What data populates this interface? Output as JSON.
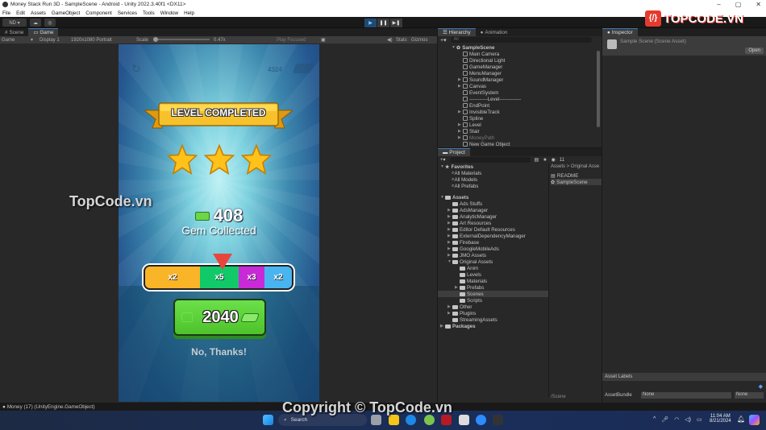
{
  "window": {
    "title": "Money Stack Run 3D - SampleScene - Android - Unity 2022.3.40f1 <DX11>",
    "controls": [
      "–",
      "▢",
      "✕"
    ]
  },
  "menu": [
    "File",
    "Edit",
    "Assets",
    "GameObject",
    "Component",
    "Services",
    "Tools",
    "Window",
    "Help"
  ],
  "toolbar": {
    "account_label": "ND ▾",
    "play_icons": [
      "▶",
      "❚❚",
      "▶❚"
    ]
  },
  "game_panel": {
    "tabs": [
      "Scene",
      "Game"
    ],
    "game_dropdown": "Game",
    "display": "Display 1",
    "resolution": "1920x1080 Portrait",
    "scale_label": "Scale",
    "scale_value": "0.47x",
    "play_mode": "Play Focused",
    "stats": "Stats",
    "gizmos": "Gizmos"
  },
  "game_ui": {
    "money_top": "4324",
    "banner_text": "LEVEL COMPLETED",
    "stars_earned": 3,
    "stars_total": 3,
    "gem_count": "408",
    "gem_label": "Gem Collected",
    "multipliers": [
      {
        "label": "x2",
        "color": "#f9b428"
      },
      {
        "label": "x5",
        "color": "#12c96a"
      },
      {
        "label": "x3",
        "color": "#c92ad8"
      },
      {
        "label": "x2",
        "color": "#49b5f0"
      }
    ],
    "claim_value": "2040",
    "no_thanks": "No, Thanks!"
  },
  "hierarchy": {
    "tabs": [
      "Hierarchy",
      "Animation"
    ],
    "search_placeholder": "All",
    "scene": "SampleScene",
    "items": [
      {
        "name": "Main Camera",
        "expandable": false
      },
      {
        "name": "Directional Light",
        "expandable": false
      },
      {
        "name": "GameManager",
        "expandable": false
      },
      {
        "name": "MenuManager",
        "expandable": false
      },
      {
        "name": "SoundManager",
        "expandable": true
      },
      {
        "name": "Canvas",
        "expandable": true
      },
      {
        "name": "EventSystem",
        "expandable": false
      },
      {
        "name": "-----------Level-------------",
        "expandable": false
      },
      {
        "name": "EndPoint",
        "expandable": false
      },
      {
        "name": "InvisibleTrack",
        "expandable": true
      },
      {
        "name": "Spline",
        "expandable": false
      },
      {
        "name": "Level",
        "expandable": true
      },
      {
        "name": "Stair",
        "expandable": true
      },
      {
        "name": "MoneyPath",
        "expandable": true,
        "disabled": true
      },
      {
        "name": "New Game Object",
        "expandable": false
      }
    ]
  },
  "project": {
    "tab": "Project",
    "count_badge": "11",
    "favorites_label": "Favorites",
    "favorites": [
      "All Materials",
      "All Models",
      "All Prefabs"
    ],
    "assets_label": "Assets",
    "tree": [
      {
        "name": "Ads Stuffs",
        "depth": 1,
        "expandable": false
      },
      {
        "name": "AdsManager",
        "depth": 1,
        "expandable": true
      },
      {
        "name": "AnalyticManager",
        "depth": 1,
        "expandable": true
      },
      {
        "name": "Art Resources",
        "depth": 1,
        "expandable": true
      },
      {
        "name": "Editor Default Resources",
        "depth": 1,
        "expandable": true
      },
      {
        "name": "ExternalDependencyManager",
        "depth": 1,
        "expandable": true
      },
      {
        "name": "Firebase",
        "depth": 1,
        "expandable": true
      },
      {
        "name": "GoogleMobileAds",
        "depth": 1,
        "expandable": true
      },
      {
        "name": "JMO Assets",
        "depth": 1,
        "expandable": true
      },
      {
        "name": "Original Assets",
        "depth": 1,
        "expandable": true,
        "open": true
      },
      {
        "name": "Anim",
        "depth": 2,
        "expandable": false
      },
      {
        "name": "Levels",
        "depth": 2,
        "expandable": false
      },
      {
        "name": "Materials",
        "depth": 2,
        "expandable": false
      },
      {
        "name": "Prefabs",
        "depth": 2,
        "expandable": true
      },
      {
        "name": "Scenes",
        "depth": 2,
        "expandable": false,
        "selected": true
      },
      {
        "name": "Scripts",
        "depth": 2,
        "expandable": false
      },
      {
        "name": "Other",
        "depth": 1,
        "expandable": true
      },
      {
        "name": "Plugins",
        "depth": 1,
        "expandable": true
      },
      {
        "name": "StreamingAssets",
        "depth": 1,
        "expandable": false
      }
    ],
    "packages_label": "Packages",
    "breadcrumb": "Assets > Original Asse",
    "files": [
      "README",
      "SampleScene"
    ],
    "footer_path": "/Scene"
  },
  "inspector": {
    "tab": "Inspector",
    "title": "Sample Scene (Scene Asset)",
    "open_button": "Open",
    "asset_labels": "Asset Labels",
    "assetbundle_label": "AssetBundle",
    "assetbundle_value": "None",
    "variant_value": "None"
  },
  "status": {
    "message": "Money (17) (UnityEngine.GameObject)"
  },
  "taskbar": {
    "search_placeholder": "Search",
    "time": "11:04 AM",
    "date": "8/21/2024"
  },
  "watermarks": {
    "logo": "TOPCODE.VN",
    "center": "TopCode.vn",
    "copyright": "Copyright © TopCode.vn"
  }
}
